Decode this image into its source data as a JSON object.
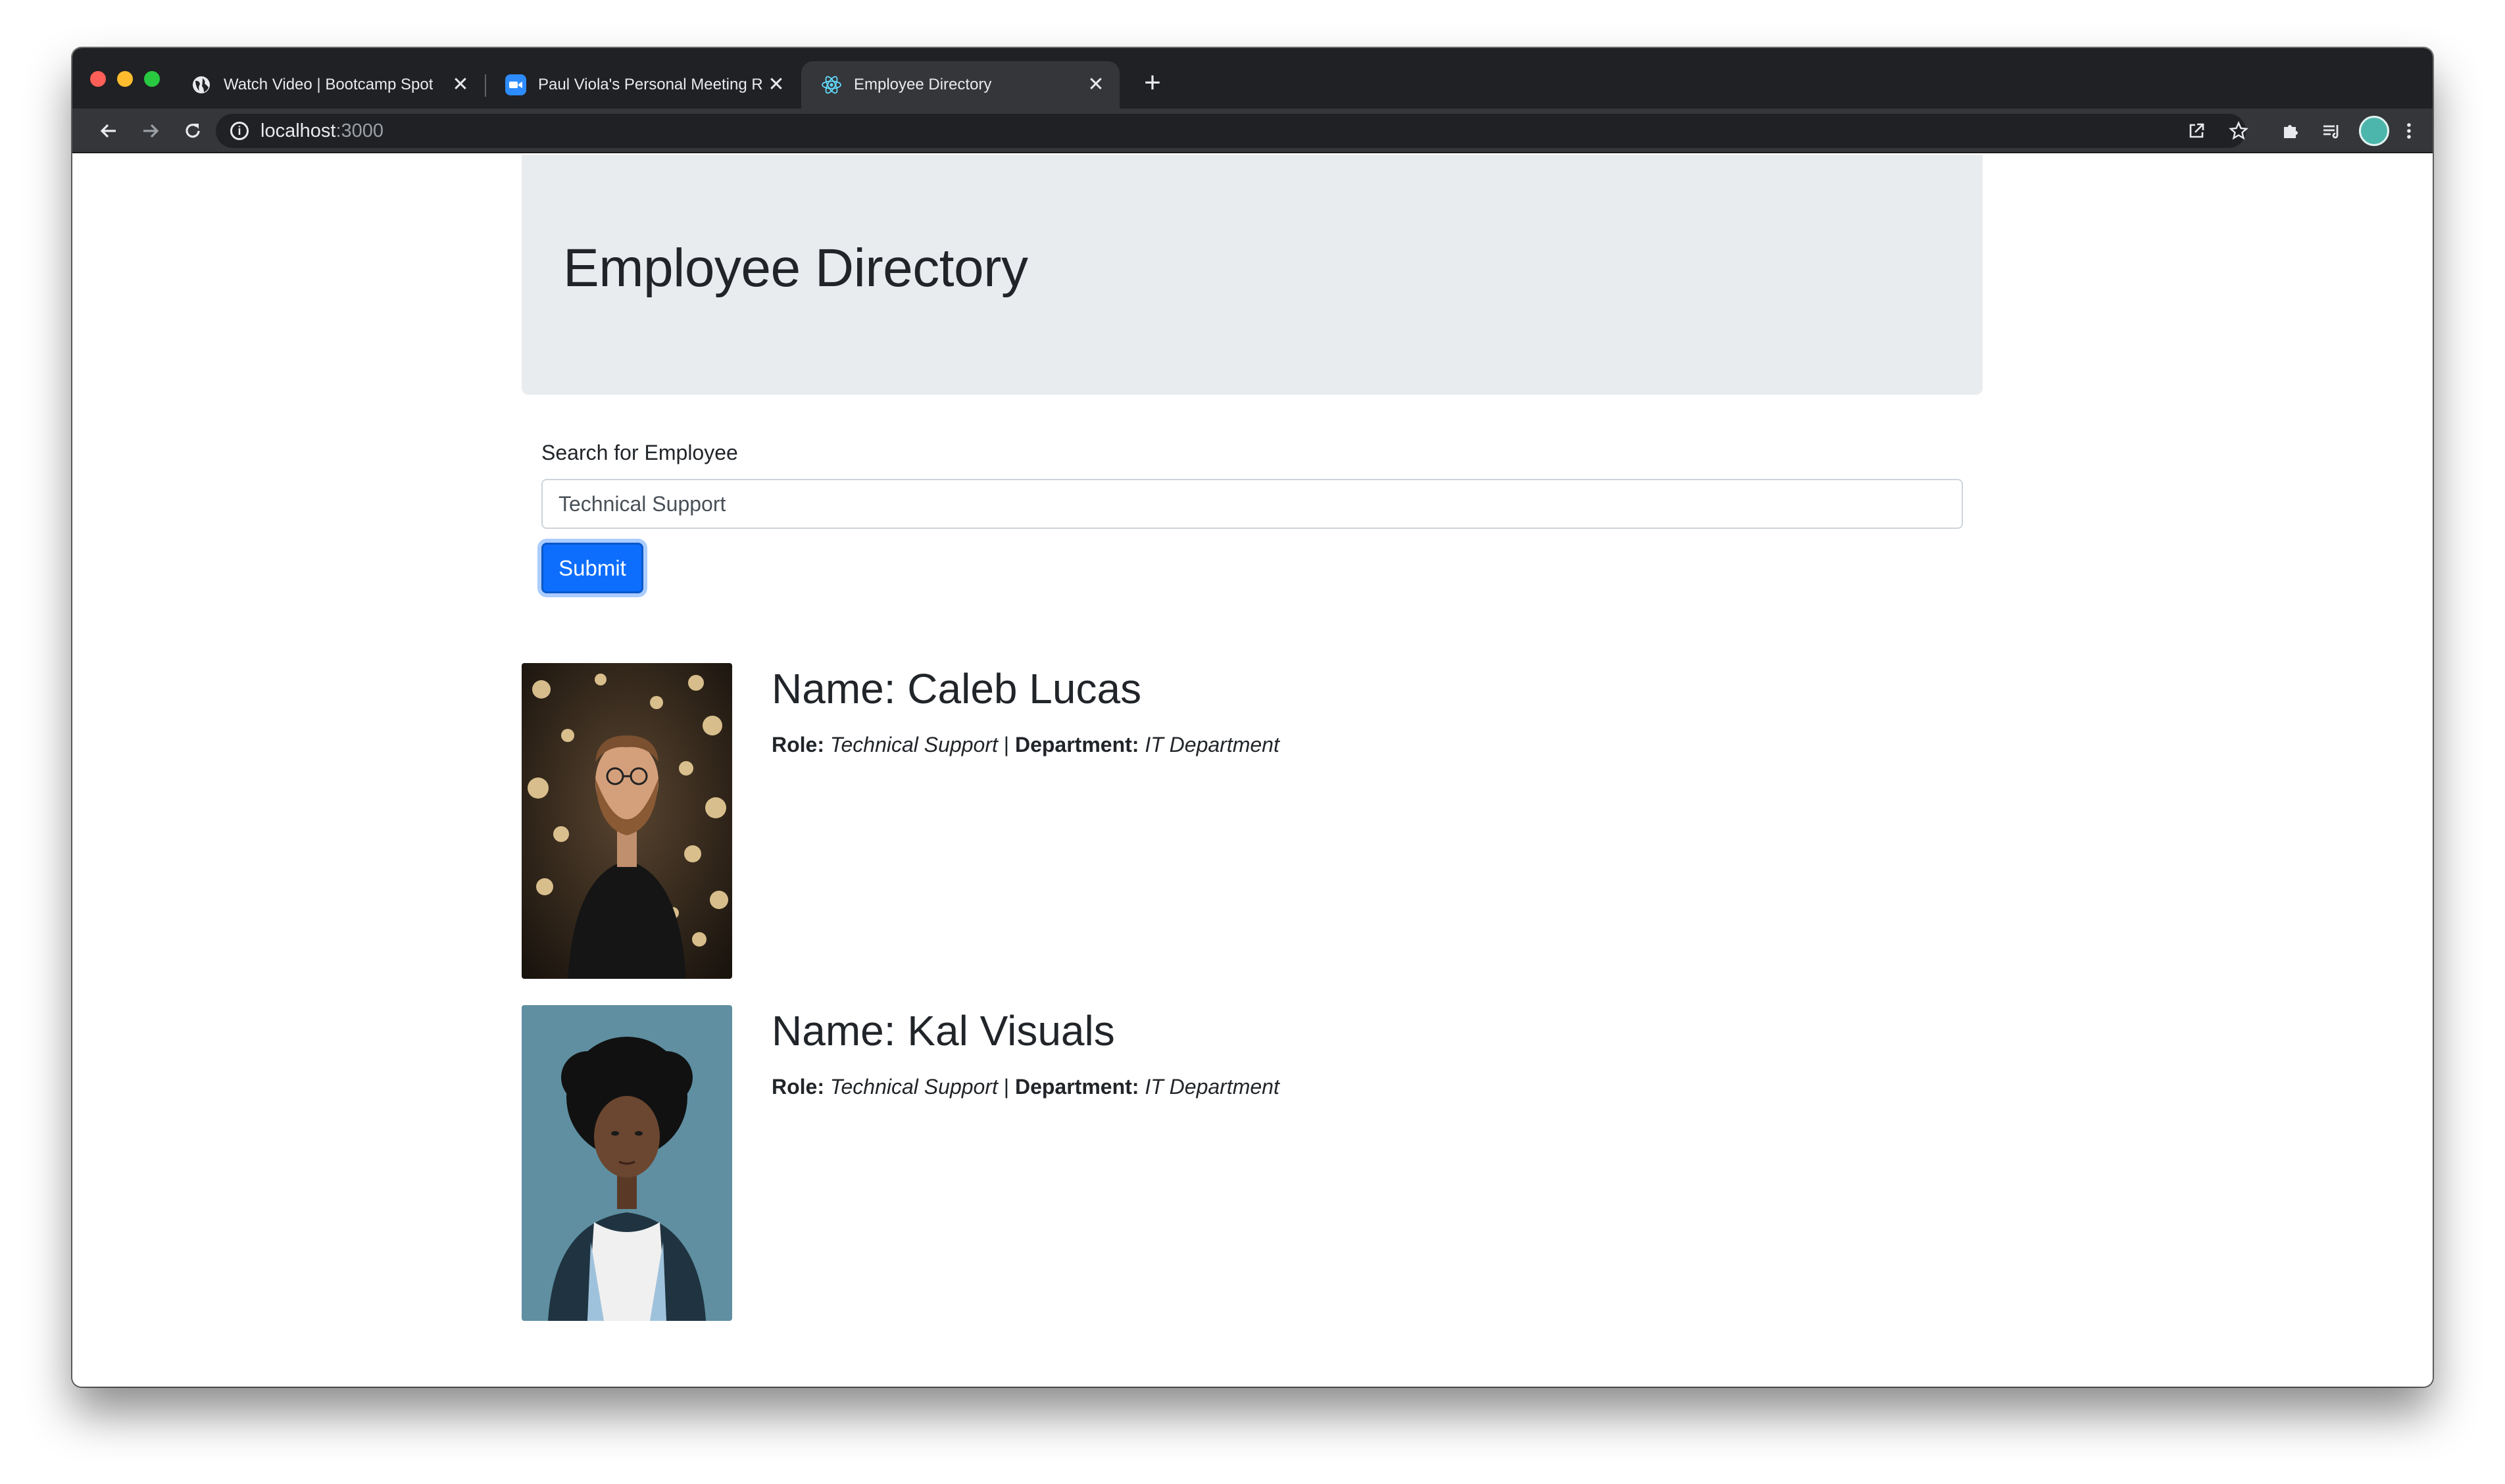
{
  "browser": {
    "tabs": [
      {
        "title": "Watch Video | Bootcamp Spot",
        "icon": "globe-icon"
      },
      {
        "title": "Paul Viola's Personal Meeting R",
        "icon": "zoom-video-icon"
      },
      {
        "title": "Employee Directory",
        "icon": "react-atom-icon",
        "active": true
      }
    ],
    "close_glyph": "✕",
    "new_tab_glyph": "+",
    "url_host": "localhost",
    "url_port": ":3000"
  },
  "page": {
    "title": "Employee Directory",
    "search": {
      "label": "Search for Employee",
      "value": "Technical Support"
    },
    "submit_label": "Submit",
    "employees": [
      {
        "name": "Name: Caleb Lucas",
        "role_label": "Role:",
        "role": "Technical Support",
        "separator": "|",
        "department_label": "Department:",
        "department": "IT Department"
      },
      {
        "name": "Name: Kal Visuals",
        "role_label": "Role:",
        "role": "Technical Support",
        "separator": "|",
        "department_label": "Department:",
        "department": "IT Department"
      }
    ]
  },
  "colors": {
    "jumbotron_bg": "#e9ecef",
    "primary_button": "#0d6efd",
    "titlebar": "#202124",
    "toolbar": "#35363a"
  }
}
